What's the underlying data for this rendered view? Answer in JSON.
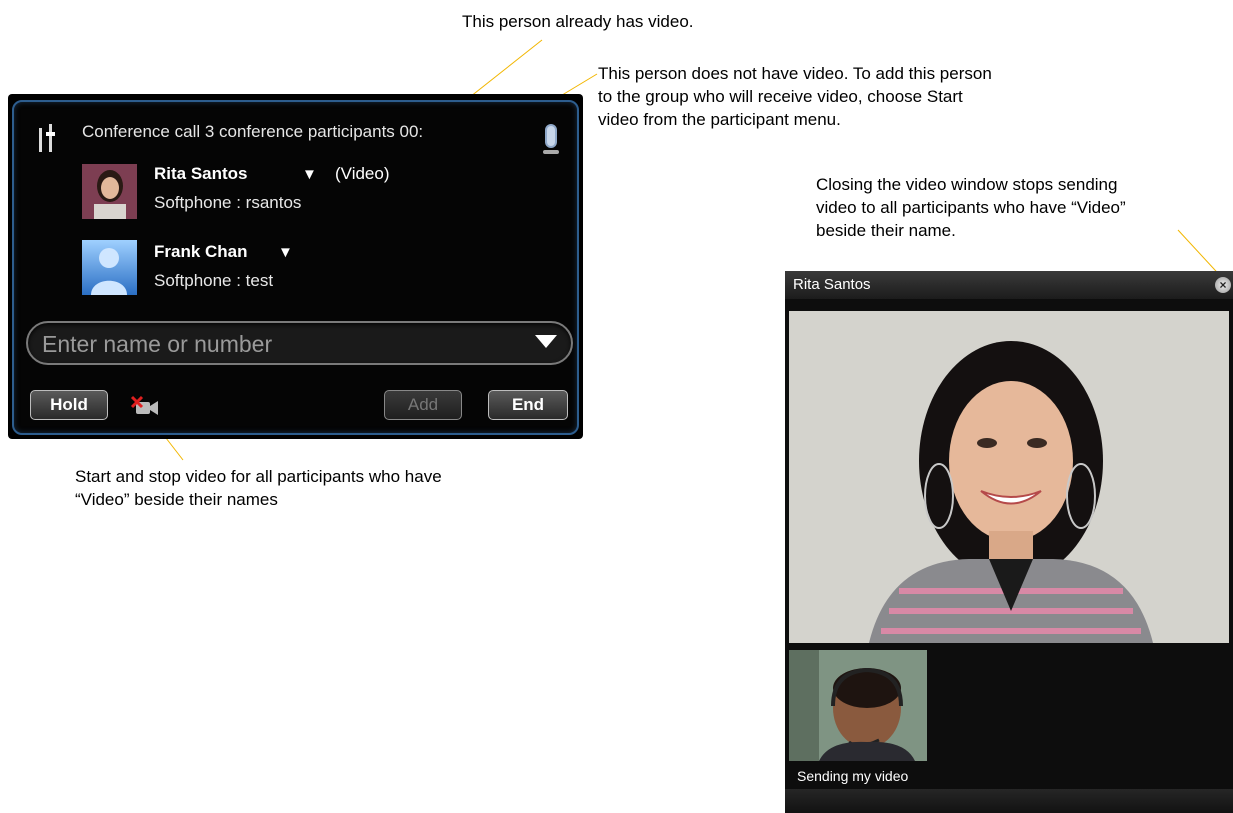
{
  "callouts": {
    "has_video": "This person already has video.",
    "no_video": "This person does not have video. To add this person to the group who will receive video, choose Start video from the participant menu.",
    "no_video_lines": [
      "This person does not have video. To add this person",
      "to the group who will receive video, choose Start",
      "video from the participant menu."
    ],
    "closing_lines": [
      "Closing the video window stops sending",
      "video to all participants who have “Video”",
      "beside their name."
    ],
    "start_stop_lines": [
      "Start and stop video for all participants who have",
      "“Video” beside their names"
    ]
  },
  "conference": {
    "title": "Conference call 3 conference participants  00:",
    "participants": [
      {
        "name": "Rita Santos",
        "tag": "(Video)",
        "sub": "Softphone :  rsantos"
      },
      {
        "name": "Frank Chan",
        "tag": "",
        "sub": "Softphone :  test"
      }
    ],
    "entry_placeholder": "Enter name or number",
    "buttons": {
      "hold": "Hold",
      "add": "Add",
      "end": "End"
    }
  },
  "video_window": {
    "title": "Rita Santos",
    "self_label": "Sending my video"
  },
  "colors": {
    "leader": "#f2b600",
    "frame_border": "#2d5d8e"
  },
  "icons": [
    "volume-slider-icon",
    "microphone-icon",
    "dropdown-arrow-icon",
    "video-off-icon",
    "close-icon"
  ]
}
